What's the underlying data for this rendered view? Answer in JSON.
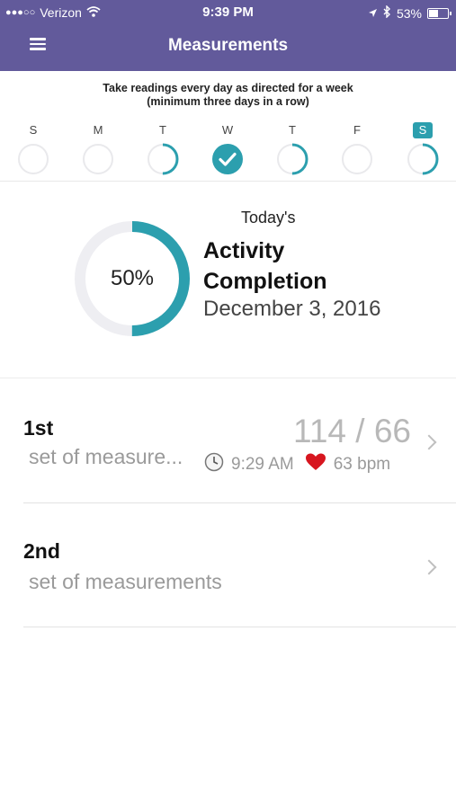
{
  "status_bar": {
    "carrier": "Verizon",
    "signal_dots": "●●●○○",
    "time": "9:39 PM",
    "battery": "53%",
    "battery_level": 0.53
  },
  "nav": {
    "title": "Measurements",
    "menu_icon": "hamburger-icon"
  },
  "week": {
    "instruction_line1": "Take readings every day as directed for a week",
    "instruction_line2": "(minimum three days in a row)",
    "days": [
      {
        "letter": "S",
        "state": "empty",
        "progress": 0
      },
      {
        "letter": "M",
        "state": "empty",
        "progress": 0
      },
      {
        "letter": "T",
        "state": "partial",
        "progress": 0.5
      },
      {
        "letter": "W",
        "state": "complete",
        "progress": 1
      },
      {
        "letter": "T",
        "state": "partial",
        "progress": 0.5
      },
      {
        "letter": "F",
        "state": "empty",
        "progress": 0
      },
      {
        "letter": "S",
        "state": "partial",
        "progress": 0.5,
        "today": true
      }
    ]
  },
  "progress": {
    "percent_label": "50%",
    "percent_value": 0.5,
    "todays_label": "Today's",
    "title_line1": "Activity",
    "title_line2": "Completion",
    "date": "December 3, 2016"
  },
  "measurements": [
    {
      "ordinal": "1st",
      "subtitle": "set of measure...",
      "reading": "114 / 66",
      "time": "9:29 AM",
      "heart_rate": "63 bpm"
    },
    {
      "ordinal": "2nd",
      "subtitle": "set of measurements"
    }
  ],
  "colors": {
    "header": "#625a9b",
    "accent": "#2c9fae",
    "ring_track": "#eeeef2"
  }
}
